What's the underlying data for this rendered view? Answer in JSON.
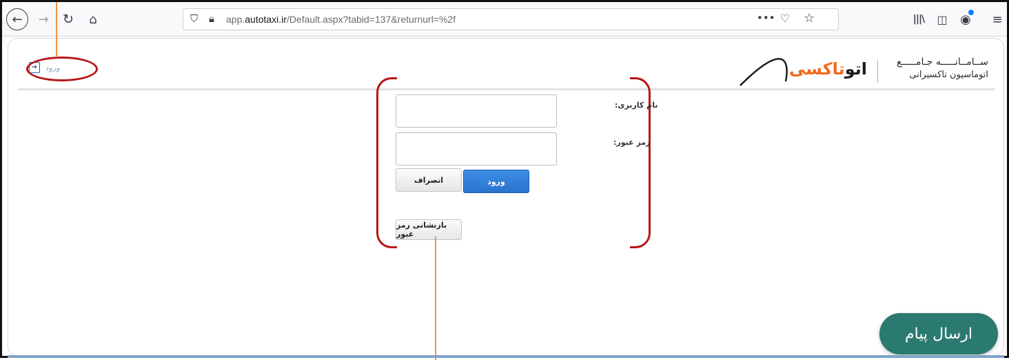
{
  "browser": {
    "url_prefix": "app.",
    "url_domain": "autotaxi.ir",
    "url_path": "/Default.aspx?tabid=137&returnurl=%2f"
  },
  "header": {
    "login_link_label": "ورود",
    "logo_title": "ســامــانـــــه جـامـــــع",
    "logo_subtitle": "اتوماسیون تاکسیرانی",
    "logo_brand_dark": "اتو",
    "logo_brand_orange": "تاکسی"
  },
  "form": {
    "username_label": "نام کاربری:",
    "password_label": "رمز عبور:",
    "username_value": "",
    "password_value": "",
    "login_button": "ورود",
    "cancel_button": "انصراف",
    "reset_password_button": "بازنشانی رمز عبور"
  },
  "chat": {
    "label": "ارسال پیام"
  },
  "colors": {
    "annotation_red": "#b81515",
    "annotation_orange": "#f0924a",
    "primary_button": "#2a73cf",
    "chat_button": "#2b7a6f",
    "brand_orange": "#f26a1b"
  }
}
